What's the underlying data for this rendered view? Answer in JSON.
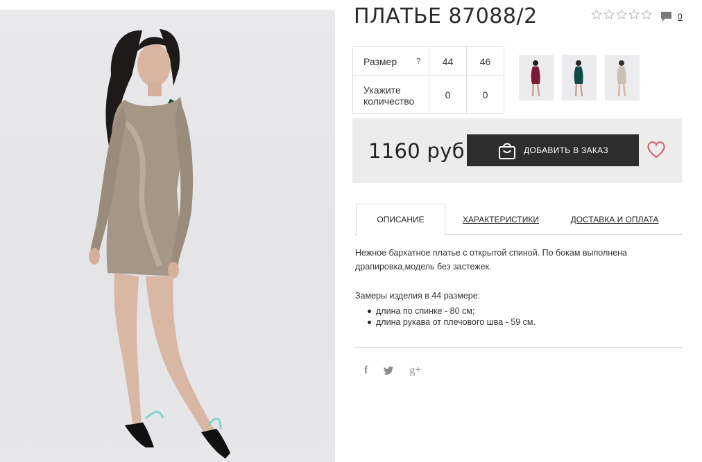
{
  "product": {
    "title": "ПЛАТЬЕ 87088/2",
    "rating_stars": 5,
    "rating_value": 0,
    "comment_count": "0"
  },
  "sizes_table": {
    "header_label": "Размер",
    "help_icon": "?",
    "sizes": [
      "44",
      "46"
    ],
    "qty_label": "Укажите количество",
    "quantities": [
      "0",
      "0"
    ]
  },
  "thumbnails": [
    {
      "name": "thumb-burgundy",
      "color": "#7a1838"
    },
    {
      "name": "thumb-teal",
      "color": "#0f4a4a"
    },
    {
      "name": "thumb-beige",
      "color": "#c9c0b6"
    }
  ],
  "purchase": {
    "price": "1160 руб",
    "add_button": "ДОБАВИТЬ В ЗАКАЗ",
    "accent": "#d9566e",
    "button_bg": "#2d2d2d"
  },
  "tabs": [
    {
      "label": "ОПИСАНИЕ",
      "active": true
    },
    {
      "label": "ХАРАКТЕРИСТИКИ",
      "active": false
    },
    {
      "label": "ДОСТАВКА И ОПЛАТА",
      "active": false
    }
  ],
  "description": {
    "text": "Нежное бархатное платье с открытой спиной. По бокам выполнена драпировка,модель без застежек.",
    "measures_title": "Замеры изделия в 44 размере:",
    "measures": [
      "длина по спинке - 80 см;",
      "длина рукава от плечового шва - 59 см."
    ]
  },
  "social": {
    "facebook": "f",
    "twitter": "twitter-icon",
    "gplus": "g+"
  }
}
